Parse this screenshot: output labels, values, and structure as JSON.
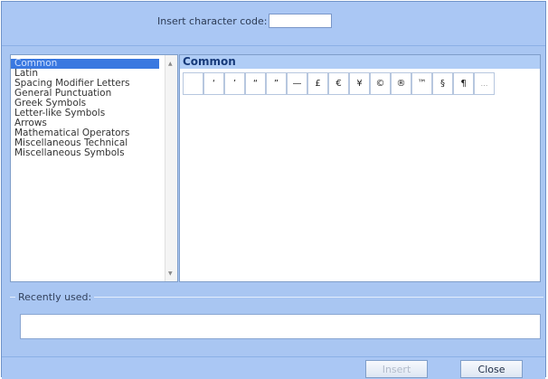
{
  "dialog": {
    "code_label": "Insert character code:",
    "code_value": ""
  },
  "categories": [
    {
      "label": "Common",
      "selected": true
    },
    {
      "label": "Latin"
    },
    {
      "label": "Spacing Modifier Letters"
    },
    {
      "label": "General Punctuation"
    },
    {
      "label": "Greek Symbols"
    },
    {
      "label": "Letter-like Symbols"
    },
    {
      "label": "Arrows"
    },
    {
      "label": "Mathematical Operators"
    },
    {
      "label": "Miscellaneous Technical"
    },
    {
      "label": "Miscellaneous Symbols"
    }
  ],
  "panel": {
    "title": "Common",
    "chars": [
      " ",
      "‘",
      "’",
      "“",
      "”",
      "—",
      "£",
      "€",
      "¥",
      "©",
      "®",
      "™",
      "§",
      "¶",
      "…"
    ]
  },
  "recent": {
    "label": "Recently used:"
  },
  "buttons": {
    "insert": "Insert",
    "close": "Close"
  }
}
